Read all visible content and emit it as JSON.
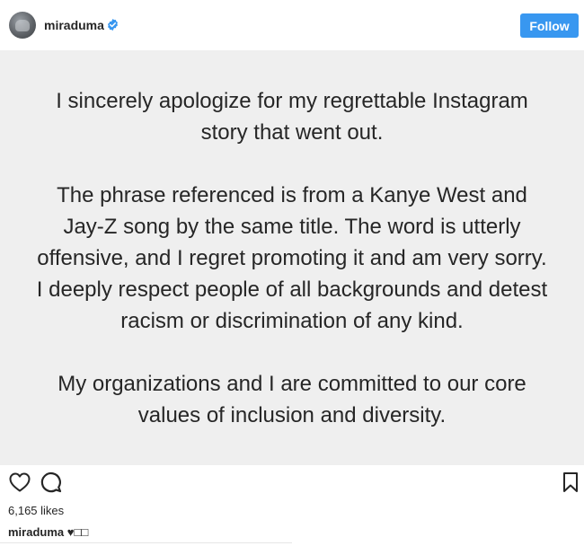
{
  "header": {
    "username": "miraduma",
    "verified_icon": "verified-badge-icon",
    "follow_label": "Follow"
  },
  "post": {
    "paragraphs": [
      "I sincerely apologize for my regrettable Instagram\nstory that went out.",
      "The phrase referenced is from a Kanye West and\nJay-Z song by the same title. The word is utterly\noffensive, and I regret promoting it and am very sorry.\nI deeply respect people of all backgrounds and detest\nracism or discrimination of any kind.",
      "My organizations and I are committed to our core\nvalues of inclusion and diversity."
    ],
    "background_color": "#efefef"
  },
  "actions": {
    "like_icon": "heart-icon",
    "comment_icon": "comment-icon",
    "save_icon": "bookmark-icon"
  },
  "likes": "6,165 likes",
  "caption": {
    "username": "miraduma",
    "text": "♥□□"
  },
  "colors": {
    "follow_button": "#3897f0",
    "verified_badge": "#3897f0",
    "text": "#262626"
  }
}
